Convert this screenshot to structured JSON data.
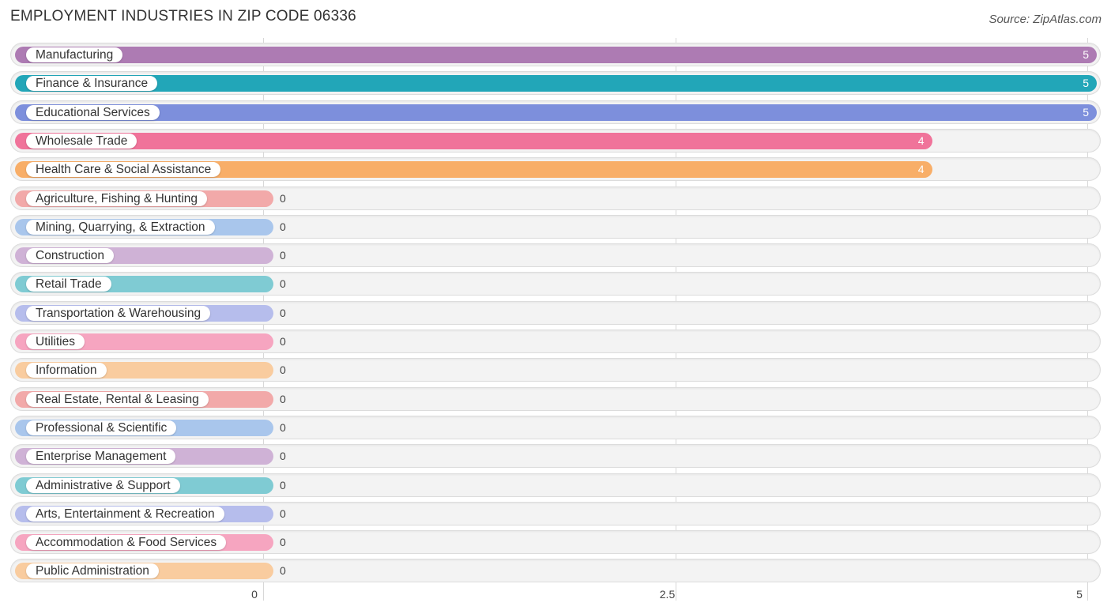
{
  "chart_data": {
    "type": "bar",
    "orientation": "horizontal",
    "title": "EMPLOYMENT INDUSTRIES IN ZIP CODE 06336",
    "source": "Source: ZipAtlas.com",
    "xlabel": "",
    "ylabel": "",
    "xlim": [
      0,
      5
    ],
    "x_ticks": [
      "0",
      "2.5",
      "5"
    ],
    "grid": true,
    "categories": [
      "Manufacturing",
      "Finance & Insurance",
      "Educational Services",
      "Wholesale Trade",
      "Health Care & Social Assistance",
      "Agriculture, Fishing & Hunting",
      "Mining, Quarrying, & Extraction",
      "Construction",
      "Retail Trade",
      "Transportation & Warehousing",
      "Utilities",
      "Information",
      "Real Estate, Rental & Leasing",
      "Professional & Scientific",
      "Enterprise Management",
      "Administrative & Support",
      "Arts, Entertainment & Recreation",
      "Accommodation & Food Services",
      "Public Administration"
    ],
    "values": [
      5,
      5,
      5,
      4,
      4,
      0,
      0,
      0,
      0,
      0,
      0,
      0,
      0,
      0,
      0,
      0,
      0,
      0,
      0
    ],
    "colors": [
      "#ad7bb3",
      "#22a6b8",
      "#7d8fdc",
      "#f0739a",
      "#f8ae68",
      "#f2a9a9",
      "#a9c6ec",
      "#cfb2d6",
      "#7fcbd3",
      "#b6bdec",
      "#f6a5c0",
      "#f9cc9f",
      "#f2a9a9",
      "#a9c6ec",
      "#cfb2d6",
      "#7fcbd3",
      "#b6bdec",
      "#f6a5c0",
      "#f9cc9f"
    ]
  }
}
